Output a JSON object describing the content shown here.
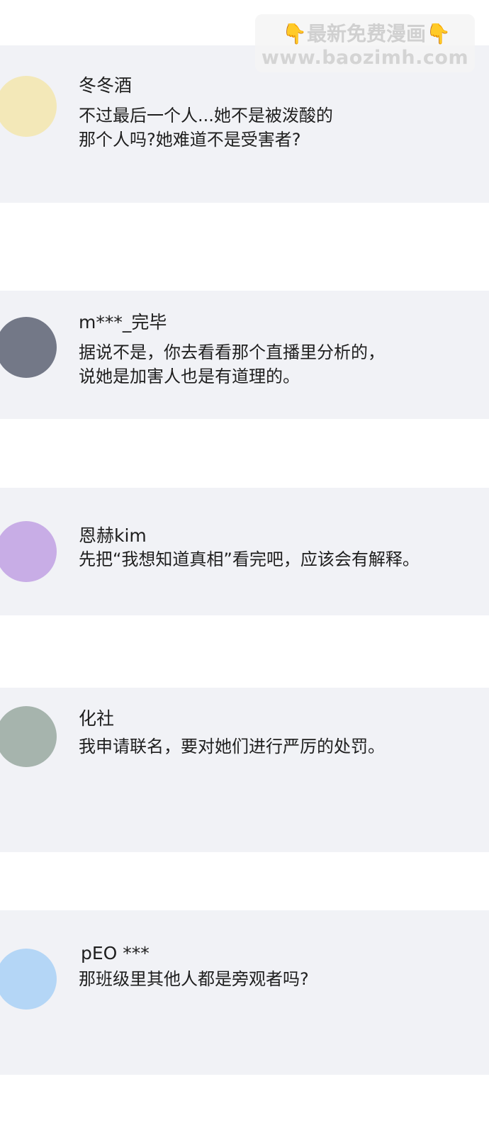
{
  "watermark": {
    "icon_left": "👇",
    "title": "最新免费漫画",
    "icon_right": "👇",
    "url": "www.baozimh.com"
  },
  "comments": [
    {
      "username": "冬冬酒",
      "lines": [
        "不过最后一个人...她不是被泼酸的",
        "那个人吗?她难道不是受害者?"
      ],
      "avatar_color": "#f3e8b8"
    },
    {
      "username": "m***_完毕",
      "lines": [
        "据说不是，你去看看那个直播里分析的，",
        "说她是加害人也是有道理的。"
      ],
      "avatar_color": "#737887"
    },
    {
      "username": "恩赫kim",
      "lines": [
        "先把“我想知道真相”看完吧，应该会有解释。"
      ],
      "avatar_color": "#c8ade6"
    },
    {
      "username": "化社",
      "lines": [
        "我申请联名，要对她们进行严厉的处罚。"
      ],
      "avatar_color": "#a6b4ad"
    },
    {
      "username": "pEO ***",
      "lines": [
        "那班级里其他人都是旁观者吗?"
      ],
      "avatar_color": "#b4d6f6"
    }
  ]
}
